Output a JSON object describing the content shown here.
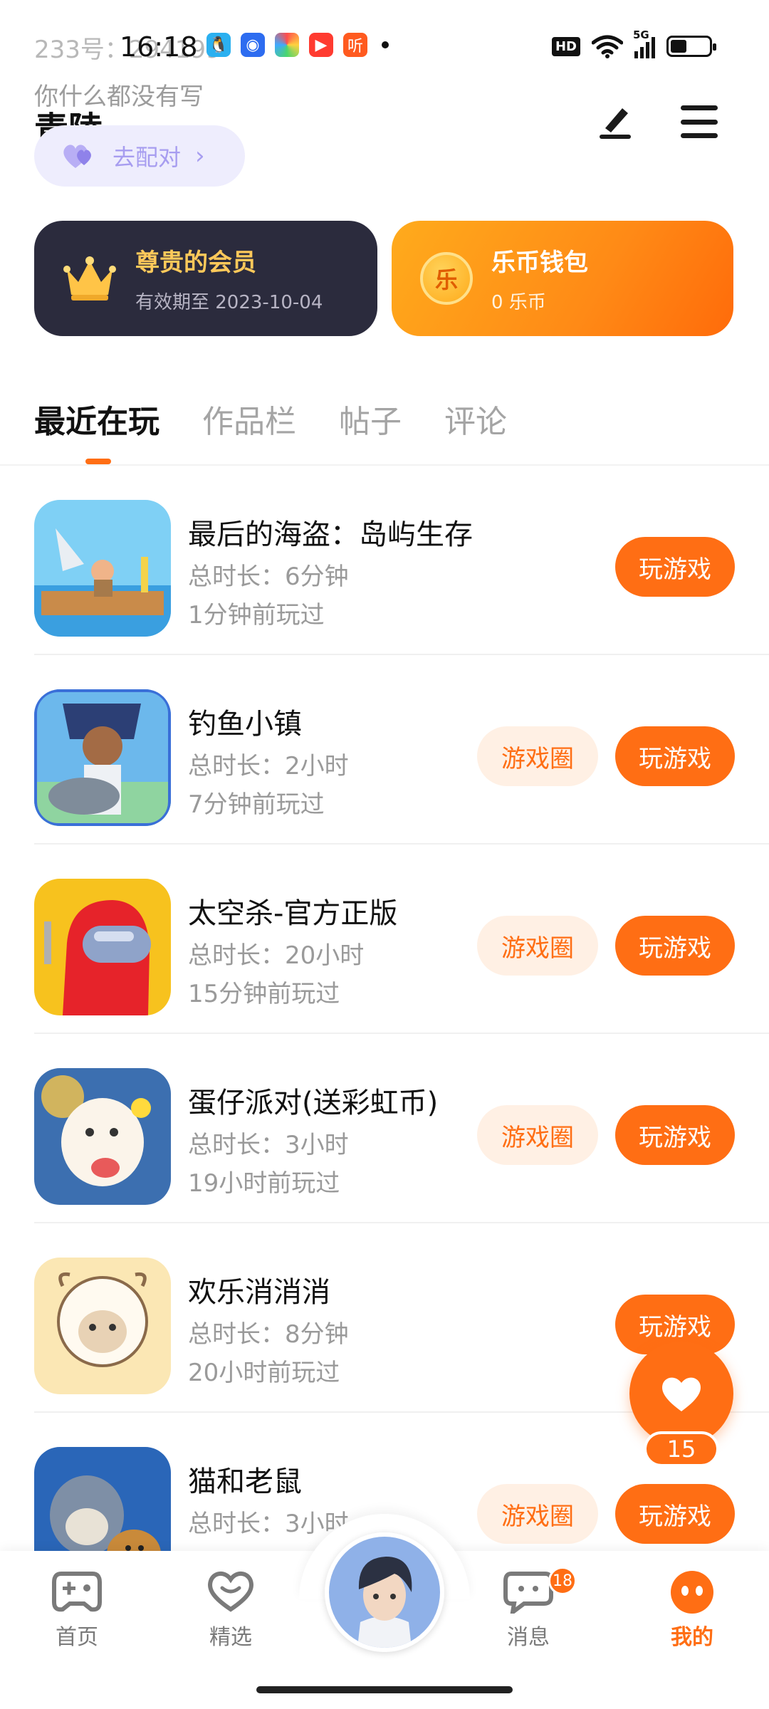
{
  "status_bar": {
    "time": "16:18",
    "network_label": "HD",
    "net_gen": "5G"
  },
  "profile": {
    "id_line": "233号：294199",
    "bio": "你什么都没有写",
    "name": "青陵",
    "pair_button": "去配对"
  },
  "cards": {
    "vip": {
      "title": "尊贵的会员",
      "subtitle": "有效期至 2023-10-04"
    },
    "wallet": {
      "title": "乐币钱包",
      "subtitle": "0 乐币",
      "coin_glyph": "乐"
    }
  },
  "tabs": [
    "最近在玩",
    "作品栏",
    "帖子",
    "评论"
  ],
  "games": [
    {
      "name": "最后的海盗：岛屿生存",
      "duration": "总时长：6分钟",
      "last_played": "1分钟前玩过",
      "has_circle": false,
      "icon_color": "#6ec3f0"
    },
    {
      "name": "钓鱼小镇",
      "duration": "总时长：2小时",
      "last_played": "7分钟前玩过",
      "has_circle": true,
      "icon_color": "#4a8fd9"
    },
    {
      "name": "太空杀-官方正版",
      "duration": "总时长：20小时",
      "last_played": "15分钟前玩过",
      "has_circle": true,
      "icon_color": "#f7c21e"
    },
    {
      "name": "蛋仔派对(送彩虹币)",
      "duration": "总时长：3小时",
      "last_played": "19小时前玩过",
      "has_circle": true,
      "icon_color": "#f2a93b"
    },
    {
      "name": "欢乐消消消",
      "duration": "总时长：8分钟",
      "last_played": "20小时前玩过",
      "has_circle": false,
      "icon_color": "#f6e6b5"
    },
    {
      "name": "猫和老鼠",
      "duration": "总时长：3小时",
      "last_played": "",
      "has_circle": true,
      "icon_color": "#c98a3a"
    }
  ],
  "buttons": {
    "play": "玩游戏",
    "circle": "游戏圈"
  },
  "floating": {
    "like_count": "15"
  },
  "nav": {
    "home": "首页",
    "featured": "精选",
    "messages": "消息",
    "messages_badge": "18",
    "mine": "我的"
  },
  "colors": {
    "accent": "#ff6e14",
    "vip_card": "#2b2b3d",
    "pair_bg": "#eeedfd"
  }
}
